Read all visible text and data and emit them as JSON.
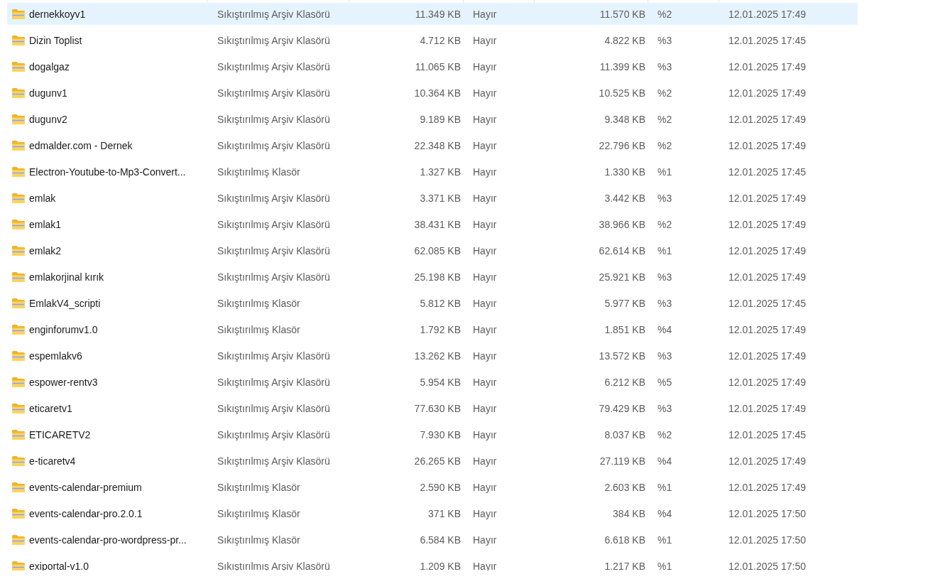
{
  "rows": [
    {
      "name": "dernekkoyv1",
      "type": "Sıkıştırılmış Arşiv Klasörü",
      "packed_size": "11.349 KB",
      "protected": "Hayır",
      "size": "11.570 KB",
      "ratio": "%2",
      "date": "12.01.2025 17:49",
      "selected": true
    },
    {
      "name": "Dizin Toplist",
      "type": "Sıkıştırılmış Arşiv Klasörü",
      "packed_size": "4.712 KB",
      "protected": "Hayır",
      "size": "4.822 KB",
      "ratio": "%3",
      "date": "12.01.2025 17:45",
      "selected": false
    },
    {
      "name": "dogalgaz",
      "type": "Sıkıştırılmış Arşiv Klasörü",
      "packed_size": "11.065 KB",
      "protected": "Hayır",
      "size": "11.399 KB",
      "ratio": "%3",
      "date": "12.01.2025 17:49",
      "selected": false
    },
    {
      "name": "dugunv1",
      "type": "Sıkıştırılmış Arşiv Klasörü",
      "packed_size": "10.364 KB",
      "protected": "Hayır",
      "size": "10.525 KB",
      "ratio": "%2",
      "date": "12.01.2025 17:49",
      "selected": false
    },
    {
      "name": "dugunv2",
      "type": "Sıkıştırılmış Arşiv Klasörü",
      "packed_size": "9.189 KB",
      "protected": "Hayır",
      "size": "9.348 KB",
      "ratio": "%2",
      "date": "12.01.2025 17:49",
      "selected": false
    },
    {
      "name": "edmalder.com - Dernek",
      "type": "Sıkıştırılmış Arşiv Klasörü",
      "packed_size": "22.348 KB",
      "protected": "Hayır",
      "size": "22.796 KB",
      "ratio": "%2",
      "date": "12.01.2025 17:49",
      "selected": false
    },
    {
      "name": "Electron-Youtube-to-Mp3-Convert...",
      "type": "Sıkıştırılmış Klasör",
      "packed_size": "1.327 KB",
      "protected": "Hayır",
      "size": "1.330 KB",
      "ratio": "%1",
      "date": "12.01.2025 17:45",
      "selected": false
    },
    {
      "name": "emlak",
      "type": "Sıkıştırılmış Arşiv Klasörü",
      "packed_size": "3.371 KB",
      "protected": "Hayır",
      "size": "3.442 KB",
      "ratio": "%3",
      "date": "12.01.2025 17:49",
      "selected": false
    },
    {
      "name": "emlak1",
      "type": "Sıkıştırılmış Arşiv Klasörü",
      "packed_size": "38.431 KB",
      "protected": "Hayır",
      "size": "38.966 KB",
      "ratio": "%2",
      "date": "12.01.2025 17:49",
      "selected": false
    },
    {
      "name": "emlak2",
      "type": "Sıkıştırılmış Arşiv Klasörü",
      "packed_size": "62.085 KB",
      "protected": "Hayır",
      "size": "62.614 KB",
      "ratio": "%1",
      "date": "12.01.2025 17:49",
      "selected": false
    },
    {
      "name": "emlakorjinal kırık",
      "type": "Sıkıştırılmış Arşiv Klasörü",
      "packed_size": "25.198 KB",
      "protected": "Hayır",
      "size": "25.921 KB",
      "ratio": "%3",
      "date": "12.01.2025 17:49",
      "selected": false
    },
    {
      "name": "EmlakV4_scripti",
      "type": "Sıkıştırılmış Klasör",
      "packed_size": "5.812 KB",
      "protected": "Hayır",
      "size": "5.977 KB",
      "ratio": "%3",
      "date": "12.01.2025 17:45",
      "selected": false
    },
    {
      "name": "enginforumv1.0",
      "type": "Sıkıştırılmış Klasör",
      "packed_size": "1.792 KB",
      "protected": "Hayır",
      "size": "1.851 KB",
      "ratio": "%4",
      "date": "12.01.2025 17:49",
      "selected": false
    },
    {
      "name": "espemlakv6",
      "type": "Sıkıştırılmış Arşiv Klasörü",
      "packed_size": "13.262 KB",
      "protected": "Hayır",
      "size": "13.572 KB",
      "ratio": "%3",
      "date": "12.01.2025 17:49",
      "selected": false
    },
    {
      "name": "espower-rentv3",
      "type": "Sıkıştırılmış Arşiv Klasörü",
      "packed_size": "5.954 KB",
      "protected": "Hayır",
      "size": "6.212 KB",
      "ratio": "%5",
      "date": "12.01.2025 17:49",
      "selected": false
    },
    {
      "name": "eticaretv1",
      "type": "Sıkıştırılmış Arşiv Klasörü",
      "packed_size": "77.630 KB",
      "protected": "Hayır",
      "size": "79.429 KB",
      "ratio": "%3",
      "date": "12.01.2025 17:49",
      "selected": false
    },
    {
      "name": "ETICARETV2",
      "type": "Sıkıştırılmış Arşiv Klasörü",
      "packed_size": "7.930 KB",
      "protected": "Hayır",
      "size": "8.037 KB",
      "ratio": "%2",
      "date": "12.01.2025 17:45",
      "selected": false
    },
    {
      "name": "e-ticaretv4",
      "type": "Sıkıştırılmış Arşiv Klasörü",
      "packed_size": "26.265 KB",
      "protected": "Hayır",
      "size": "27.119 KB",
      "ratio": "%4",
      "date": "12.01.2025 17:49",
      "selected": false
    },
    {
      "name": "events-calendar-premium",
      "type": "Sıkıştırılmış Klasör",
      "packed_size": "2.590 KB",
      "protected": "Hayır",
      "size": "2.603 KB",
      "ratio": "%1",
      "date": "12.01.2025 17:49",
      "selected": false
    },
    {
      "name": "events-calendar-pro.2.0.1",
      "type": "Sıkıştırılmış Klasör",
      "packed_size": "371 KB",
      "protected": "Hayır",
      "size": "384 KB",
      "ratio": "%4",
      "date": "12.01.2025 17:50",
      "selected": false
    },
    {
      "name": "events-calendar-pro-wordpress-pr...",
      "type": "Sıkıştırılmış Klasör",
      "packed_size": "6.584 KB",
      "protected": "Hayır",
      "size": "6.618 KB",
      "ratio": "%1",
      "date": "12.01.2025 17:50",
      "selected": false
    },
    {
      "name": "exiportal-v1.0",
      "type": "Sıkıştırılmış Arşiv Klasörü",
      "packed_size": "1.209 KB",
      "protected": "Hayır",
      "size": "1.217 KB",
      "ratio": "%1",
      "date": "12.01.2025 17:50",
      "selected": false
    }
  ]
}
